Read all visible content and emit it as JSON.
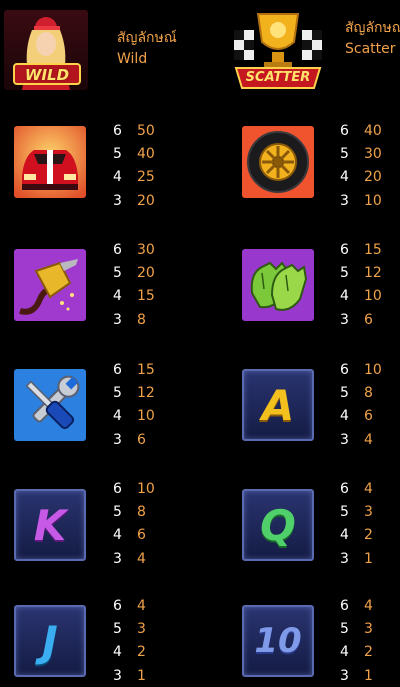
{
  "header": {
    "wild_label": "สัญลักษณ์ Wild",
    "scatter_label": "สัญลักษณ์ Scatter",
    "wild_badge": "WILD",
    "scatter_badge": "SCATTER"
  },
  "letters": {
    "A": "A",
    "K": "K",
    "Q": "Q",
    "J": "J",
    "TEN": "10"
  },
  "colors": {
    "background": "#000000",
    "count_text": "#ffffff",
    "value_text": "#f0a24a"
  },
  "symbols": [
    {
      "name": "car",
      "icon": "red-car-icon",
      "payouts": [
        {
          "count": "6",
          "value": "50"
        },
        {
          "count": "5",
          "value": "40"
        },
        {
          "count": "4",
          "value": "25"
        },
        {
          "count": "3",
          "value": "20"
        }
      ]
    },
    {
      "name": "tire",
      "icon": "tire-icon",
      "payouts": [
        {
          "count": "6",
          "value": "40"
        },
        {
          "count": "5",
          "value": "30"
        },
        {
          "count": "4",
          "value": "20"
        },
        {
          "count": "3",
          "value": "10"
        }
      ]
    },
    {
      "name": "fuel-nozzle",
      "icon": "fuel-nozzle-icon",
      "payouts": [
        {
          "count": "6",
          "value": "30"
        },
        {
          "count": "5",
          "value": "20"
        },
        {
          "count": "4",
          "value": "15"
        },
        {
          "count": "3",
          "value": "8"
        }
      ]
    },
    {
      "name": "gloves",
      "icon": "racing-gloves-icon",
      "payouts": [
        {
          "count": "6",
          "value": "15"
        },
        {
          "count": "5",
          "value": "12"
        },
        {
          "count": "4",
          "value": "10"
        },
        {
          "count": "3",
          "value": "6"
        }
      ]
    },
    {
      "name": "tools",
      "icon": "wrench-screwdriver-icon",
      "payouts": [
        {
          "count": "6",
          "value": "15"
        },
        {
          "count": "5",
          "value": "12"
        },
        {
          "count": "4",
          "value": "10"
        },
        {
          "count": "3",
          "value": "6"
        }
      ]
    },
    {
      "name": "A",
      "icon": "letter-a-icon",
      "payouts": [
        {
          "count": "6",
          "value": "10"
        },
        {
          "count": "5",
          "value": "8"
        },
        {
          "count": "4",
          "value": "6"
        },
        {
          "count": "3",
          "value": "4"
        }
      ]
    },
    {
      "name": "K",
      "icon": "letter-k-icon",
      "payouts": [
        {
          "count": "6",
          "value": "10"
        },
        {
          "count": "5",
          "value": "8"
        },
        {
          "count": "4",
          "value": "6"
        },
        {
          "count": "3",
          "value": "4"
        }
      ]
    },
    {
      "name": "Q",
      "icon": "letter-q-icon",
      "payouts": [
        {
          "count": "6",
          "value": "4"
        },
        {
          "count": "5",
          "value": "3"
        },
        {
          "count": "4",
          "value": "2"
        },
        {
          "count": "3",
          "value": "1"
        }
      ]
    },
    {
      "name": "J",
      "icon": "letter-j-icon",
      "payouts": [
        {
          "count": "6",
          "value": "4"
        },
        {
          "count": "5",
          "value": "3"
        },
        {
          "count": "4",
          "value": "2"
        },
        {
          "count": "3",
          "value": "1"
        }
      ]
    },
    {
      "name": "10",
      "icon": "number-ten-icon",
      "payouts": [
        {
          "count": "6",
          "value": "4"
        },
        {
          "count": "5",
          "value": "3"
        },
        {
          "count": "4",
          "value": "2"
        },
        {
          "count": "3",
          "value": "1"
        }
      ]
    }
  ]
}
